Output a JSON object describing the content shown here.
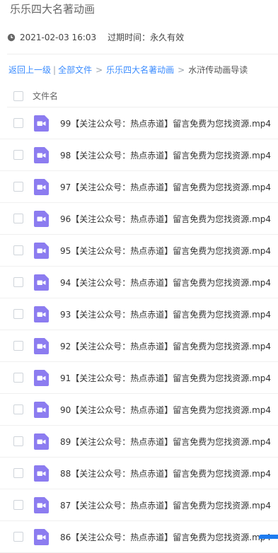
{
  "share": {
    "title": "乐乐四大名著动画",
    "date": "2021-02-03 16:03",
    "expire": "过期时间：永久有效"
  },
  "breadcrumb": {
    "back": "返回上一级",
    "all_files": "全部文件",
    "folder": "乐乐四大名著动画",
    "current": "水浒传动画导读",
    "separator": "|",
    "arrow": ">"
  },
  "list": {
    "header_label": "文件名",
    "files": [
      "99【关注公众号：热点赤道】留言免费为您找资源.mp4",
      "98【关注公众号：热点赤道】留言免费为您找资源.mp4",
      "97【关注公众号：热点赤道】留言免费为您找资源.mp4",
      "96【关注公众号：热点赤道】留言免费为您找资源.mp4",
      "95【关注公众号：热点赤道】留言免费为您找资源.mp4",
      "94【关注公众号：热点赤道】留言免费为您找资源.mp4",
      "93【关注公众号：热点赤道】留言免费为您找资源.mp4",
      "92【关注公众号：热点赤道】留言免费为您找资源.mp4",
      "91【关注公众号：热点赤道】留言免费为您找资源.mp4",
      "90【关注公众号：热点赤道】留言免费为您找资源.mp4",
      "89【关注公众号：热点赤道】留言免费为您找资源.mp4",
      "88【关注公众号：热点赤道】留言免费为您找资源.mp4",
      "87【关注公众号：热点赤道】留言免费为您找资源.mp4",
      "86【关注公众号：热点赤道】留言免费为您找资源.mp4"
    ]
  },
  "icons": {
    "clock": "clock-icon",
    "file": "video-file-icon"
  },
  "colors": {
    "link": "#3b8cff",
    "file_icon": "#8c7cf0",
    "accent": "#1e7cf0"
  }
}
